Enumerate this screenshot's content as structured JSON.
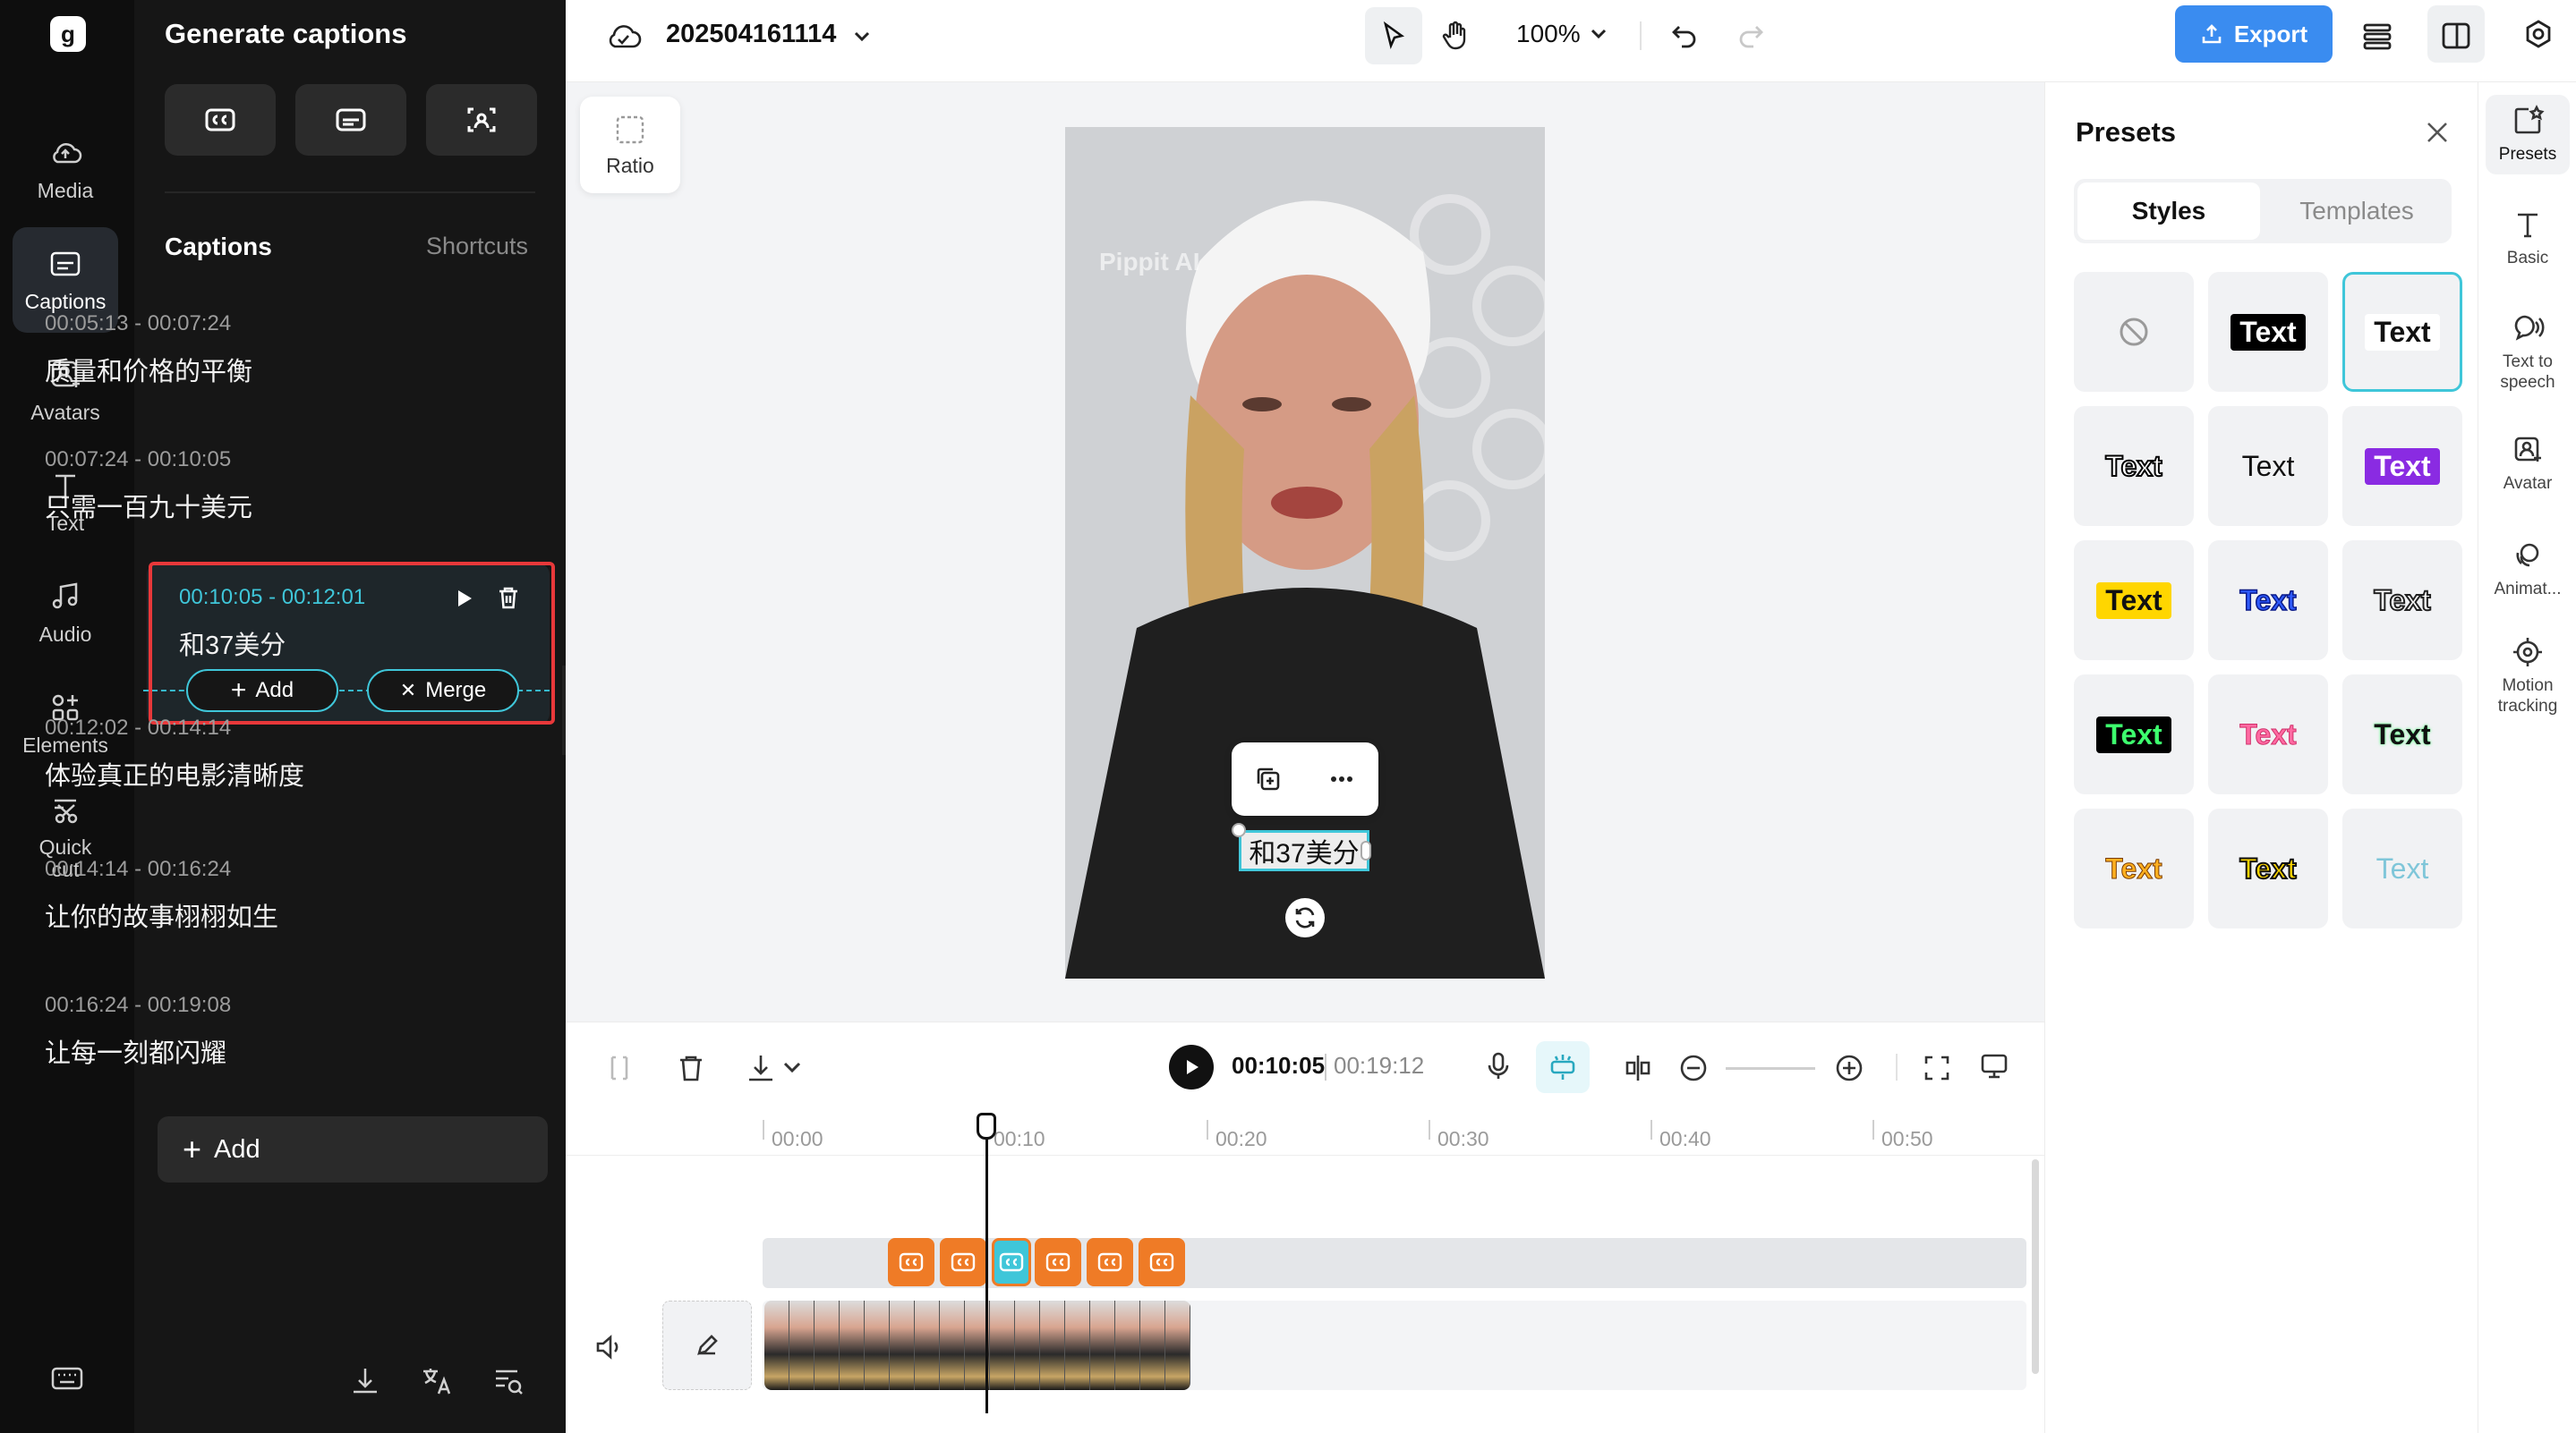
{
  "left_rail": {
    "logo": "Pippit logo",
    "items": [
      {
        "label": "Media",
        "icon": "cloud-icon"
      },
      {
        "label": "Captions",
        "icon": "captions-icon",
        "active": true
      },
      {
        "label": "Avatars",
        "icon": "avatar-icon"
      },
      {
        "label": "Text",
        "icon": "text-icon"
      },
      {
        "label": "Audio",
        "icon": "music-icon"
      },
      {
        "label": "Elements",
        "icon": "elements-icon"
      },
      {
        "label": "Quick cut",
        "icon": "scissors-icon"
      }
    ],
    "bottom_icon": "keyboard-icon"
  },
  "caption_panel": {
    "title": "Generate captions",
    "tools": [
      "cc-icon",
      "subtitle-icon",
      "scan-icon"
    ],
    "section_title": "Captions",
    "shortcuts": "Shortcuts",
    "captions": [
      {
        "time": "00:05:13 - 00:07:24",
        "text": "质量和价格的平衡"
      },
      {
        "time": "00:07:24 - 00:10:05",
        "text": "只需一百九十美元"
      },
      {
        "time": "00:10:05 - 00:12:01",
        "text": "和37美分",
        "active": true
      },
      {
        "time": "00:12:02 - 00:14:14",
        "text": "体验真正的电影清晰度"
      },
      {
        "time": "00:14:14 - 00:16:24",
        "text": "让你的故事栩栩如生"
      },
      {
        "time": "00:16:24 - 00:19:08",
        "text": "让每一刻都闪耀"
      }
    ],
    "add_pill": "Add",
    "merge_pill": "Merge",
    "add_button": "Add",
    "bottom_icons": [
      "download-icon",
      "translate-icon",
      "search-list-icon"
    ]
  },
  "topbar": {
    "project_name": "202504161114",
    "zoom": "100%",
    "export": "Export",
    "export_color": "#3a8cf0"
  },
  "canvas": {
    "ratio_label": "Ratio",
    "watermark": "Pippit AI",
    "caption_overlay": "和37美分"
  },
  "presets": {
    "title": "Presets",
    "tab_active": "Styles",
    "tab_inactive": "Templates",
    "tiles": [
      "Text",
      "Text",
      "Text",
      "Text",
      "Text",
      "Text",
      "Text",
      "Text",
      "Text",
      "Text",
      "Text",
      "Text",
      "Text",
      "Text"
    ]
  },
  "right_rail": {
    "items": [
      {
        "label": "Presets",
        "active": true
      },
      {
        "label": "Basic"
      },
      {
        "label": "Text to speech"
      },
      {
        "label": "Avatar"
      },
      {
        "label": "Animat..."
      },
      {
        "label": "Motion tracking"
      }
    ]
  },
  "timeline": {
    "current_time": "00:10:05",
    "total_time": "00:19:12",
    "ticks": [
      "00:00",
      "00:10",
      "00:20",
      "00:30",
      "00:40",
      "00:50"
    ],
    "caption_chips": 6
  },
  "colors": {
    "accent": "#3fc6d9",
    "highlight_frame": "#e8383a",
    "caption_chip": "#ef7b26"
  }
}
